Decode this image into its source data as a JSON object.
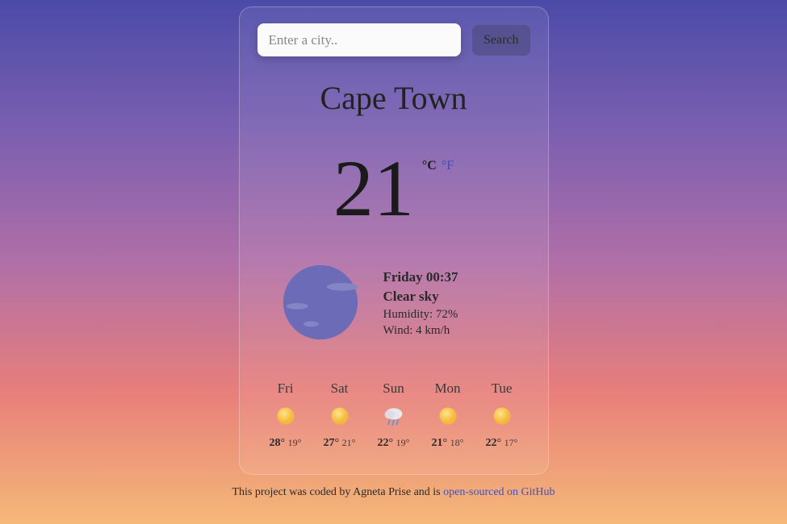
{
  "search": {
    "placeholder": "Enter a city..",
    "button": "Search"
  },
  "city": "Cape Town",
  "current": {
    "temp": "21",
    "unit_c": "°C",
    "unit_f": "°F",
    "datetime": "Friday 00:37",
    "description": "Clear sky",
    "humidity_label": "Humidity:",
    "humidity_value": "72%",
    "wind_label": "Wind:",
    "wind_value": "4 km/h",
    "icon": "moon"
  },
  "forecast": [
    {
      "day": "Fri",
      "icon": "sun",
      "high": "28",
      "low": "19"
    },
    {
      "day": "Sat",
      "icon": "sun",
      "high": "27",
      "low": "21"
    },
    {
      "day": "Sun",
      "icon": "rain",
      "high": "22",
      "low": "19"
    },
    {
      "day": "Mon",
      "icon": "sun",
      "high": "21",
      "low": "18"
    },
    {
      "day": "Tue",
      "icon": "sun",
      "high": "22",
      "low": "17"
    }
  ],
  "footer": {
    "text": "This project was coded by Agneta Prise and is ",
    "link": "open-sourced on GitHub"
  }
}
